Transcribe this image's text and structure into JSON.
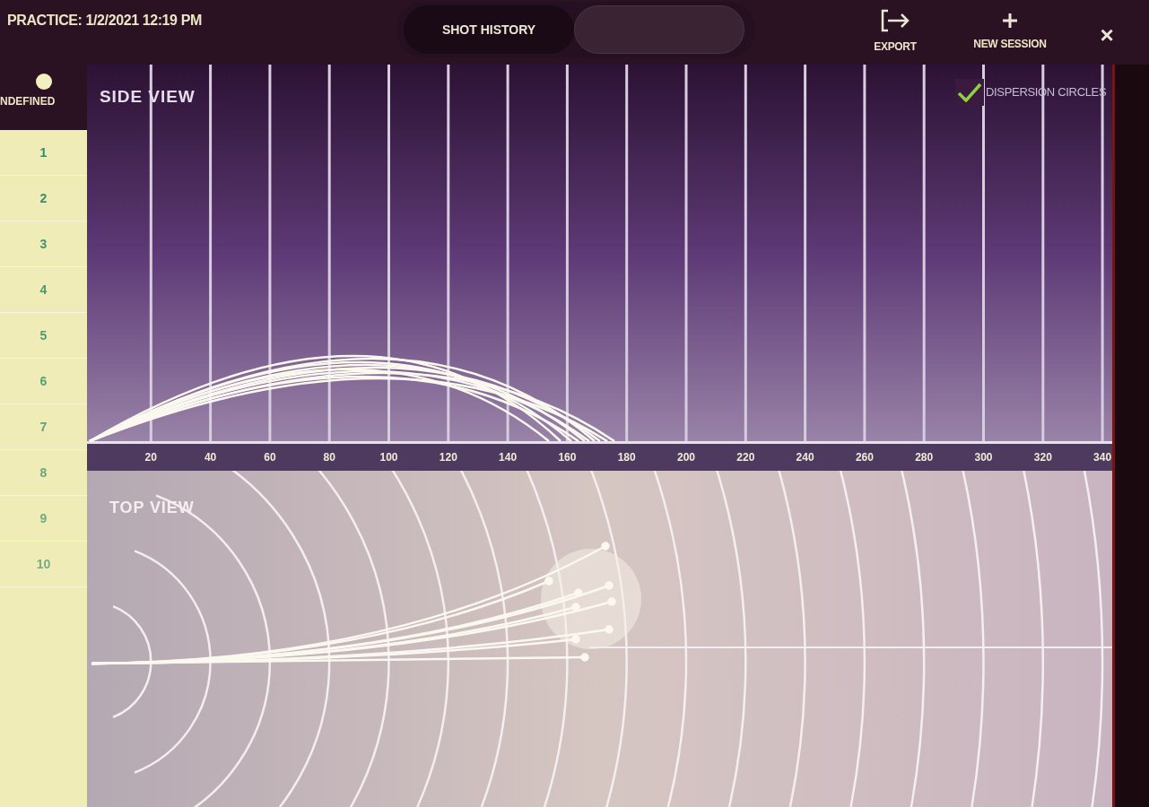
{
  "header": {
    "title": "PRACTICE: 1/2/2021 12:19 PM"
  },
  "tabs": [
    {
      "label": "SHOT HISTORY",
      "selected": true
    },
    {
      "selected": false
    }
  ],
  "actions": [
    {
      "kind": "export",
      "label": "EXPORT"
    },
    {
      "kind": "add",
      "label": "NEW SESSION"
    }
  ],
  "close": "×",
  "club": {
    "label": "NDEFINED"
  },
  "shots": [
    "1",
    "2",
    "3",
    "4",
    "5",
    "6",
    "7",
    "8",
    "9",
    "10"
  ],
  "side_view": {
    "title": "SIDE VIEW",
    "dispersion_circles": {
      "label": "DISPERSION CIRCLES",
      "checked": true
    }
  },
  "distance_axis": [
    "20",
    "40",
    "60",
    "80",
    "100",
    "120",
    "140",
    "160",
    "180",
    "200",
    "220",
    "240",
    "260",
    "280",
    "300",
    "320",
    "340"
  ],
  "top_view": {
    "title": "TOP VIEW"
  }
}
